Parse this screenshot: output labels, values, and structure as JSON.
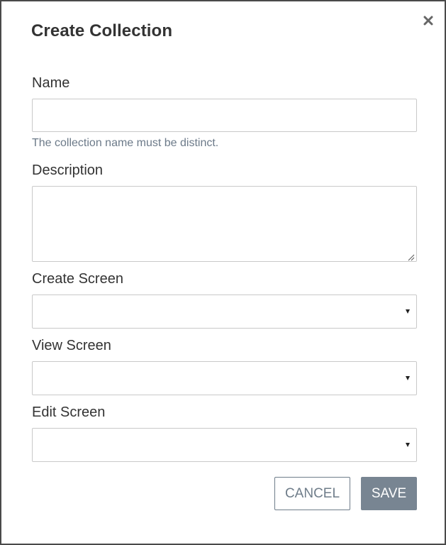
{
  "dialog": {
    "title": "Create Collection",
    "close_icon": "close-icon"
  },
  "form": {
    "name": {
      "label": "Name",
      "value": "",
      "helper": "The collection name must be distinct."
    },
    "description": {
      "label": "Description",
      "value": ""
    },
    "create_screen": {
      "label": "Create Screen",
      "selected": ""
    },
    "view_screen": {
      "label": "View Screen",
      "selected": ""
    },
    "edit_screen": {
      "label": "Edit Screen",
      "selected": ""
    }
  },
  "actions": {
    "cancel_label": "CANCEL",
    "save_label": "SAVE"
  },
  "colors": {
    "primary_button": "#788592",
    "helper_text": "#6c7a89",
    "border": "#c9c9c9",
    "frame": "#4a4a4a"
  }
}
